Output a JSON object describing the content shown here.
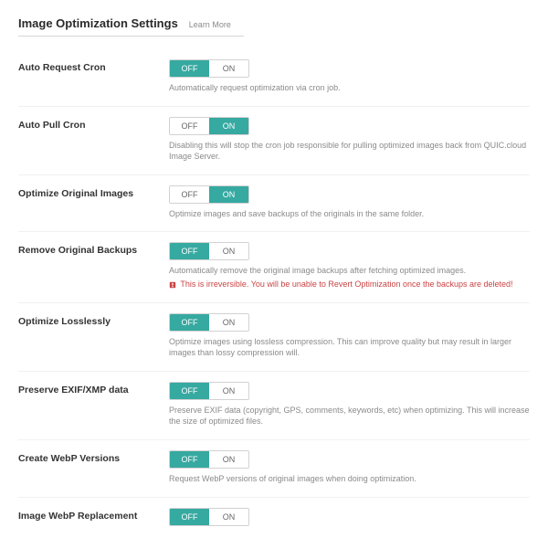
{
  "header": {
    "title": "Image Optimization Settings",
    "learn_more": "Learn More"
  },
  "labels": {
    "off": "OFF",
    "on": "ON"
  },
  "settings": [
    {
      "id": "auto-request-cron",
      "label": "Auto Request Cron",
      "value": "off",
      "desc": "Automatically request optimization via cron job.",
      "warn": null
    },
    {
      "id": "auto-pull-cron",
      "label": "Auto Pull Cron",
      "value": "on",
      "desc": "Disabling this will stop the cron job responsible for pulling optimized images back from QUIC.cloud Image Server.",
      "warn": null
    },
    {
      "id": "optimize-original-images",
      "label": "Optimize Original Images",
      "value": "on",
      "desc": "Optimize images and save backups of the originals in the same folder.",
      "warn": null
    },
    {
      "id": "remove-original-backups",
      "label": "Remove Original Backups",
      "value": "off",
      "desc": "Automatically remove the original image backups after fetching optimized images.",
      "warn": "This is irreversible. You will be unable to Revert Optimization once the backups are deleted!"
    },
    {
      "id": "optimize-losslessly",
      "label": "Optimize Losslessly",
      "value": "off",
      "desc": "Optimize images using lossless compression. This can improve quality but may result in larger images than lossy compression will.",
      "warn": null
    },
    {
      "id": "preserve-exif-xmp",
      "label": "Preserve EXIF/XMP data",
      "value": "off",
      "desc": "Preserve EXIF data (copyright, GPS, comments, keywords, etc) when optimizing. This will increase the size of optimized files.",
      "warn": null
    },
    {
      "id": "create-webp-versions",
      "label": "Create WebP Versions",
      "value": "off",
      "desc": "Request WebP versions of original images when doing optimization.",
      "warn": null
    },
    {
      "id": "image-webp-replacement",
      "label": "Image WebP Replacement",
      "value": "off",
      "desc": "",
      "warn": null
    }
  ]
}
